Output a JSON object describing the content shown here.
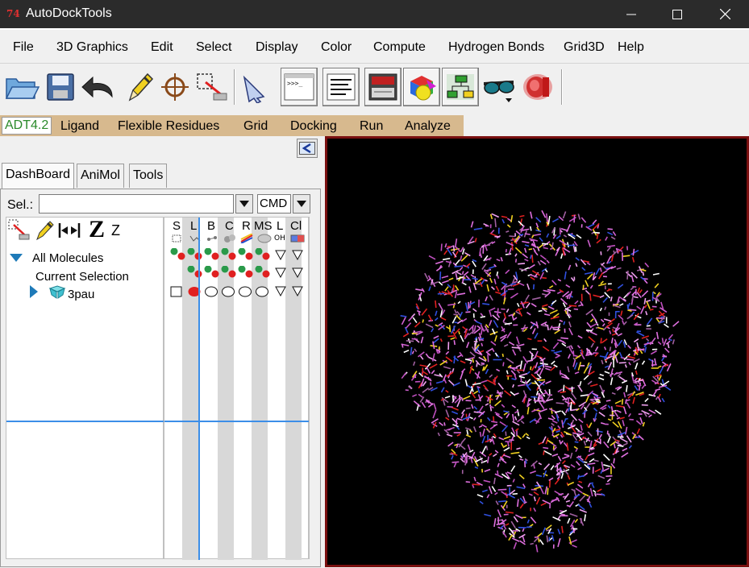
{
  "window": {
    "title": "AutoDockTools",
    "icon_text": "74"
  },
  "menubar": [
    "File",
    "3D Graphics",
    "Edit",
    "Select",
    "Display",
    "Color",
    "Compute",
    "Hydrogen Bonds",
    "Grid3D",
    "Help"
  ],
  "toolbar": {
    "icons": [
      "open-folder-icon",
      "save-icon",
      "undo-icon",
      "pencil-icon",
      "crosshair-icon",
      "pick-selection-icon",
      "pointer-hand-icon",
      "python-shell-icon",
      "text-lines-icon",
      "dashboard-window-icon",
      "color-cube-icon",
      "hierarchy-icon",
      "stereo-glasses-icon",
      "red-surface-icon"
    ]
  },
  "adt_menu": [
    "ADT4.2",
    "Ligand",
    "Flexible Residues",
    "Grid",
    "Docking",
    "Run",
    "Analyze"
  ],
  "tabs": [
    "DashBoard",
    "AniMol",
    "Tools"
  ],
  "dashboard": {
    "sel_label": "Sel.:",
    "sel_value": "",
    "cmd_value": "CMD",
    "tool_z_large": "Z",
    "tool_z_small": "Z",
    "columns": [
      "S",
      "L",
      "B",
      "C",
      "R",
      "MS",
      "L",
      "Cl"
    ],
    "column_subicons": [
      "dotted-square-icon",
      "line-icon",
      "ball-stick-icon",
      "cpk-icon",
      "ribbon-icon",
      "molecular-surface-icon",
      "label-oh-icon",
      "color-bar-icon"
    ],
    "column_sublabel_oh": "OH",
    "tree": {
      "all": "All Molecules",
      "current": "Current Selection",
      "molecule": "3pau"
    }
  },
  "colors": {
    "titlebar": "#2b2b2b",
    "adt_menu_bg": "#d7b98e",
    "adt_active_text": "#2a8a2a",
    "viewer_border": "#7a1010",
    "accent_line": "#3c8ee8",
    "dot_green": "#2a9a4a",
    "dot_red": "#e02020"
  }
}
